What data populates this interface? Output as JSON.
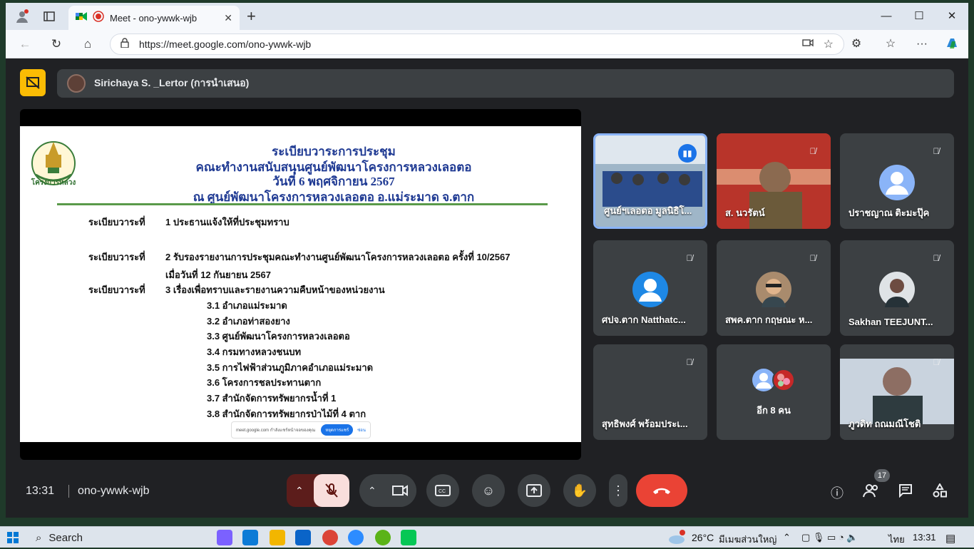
{
  "browser": {
    "tab_title": "Meet - ono-ywwk-wjb",
    "url": "https://meet.google.com/ono-ywwk-wjb"
  },
  "meet": {
    "presenter_name": "Sirichaya S. _Lertor (การนำเสนอ)",
    "time": "13:31",
    "meeting_code": "ono-ywwk-wjb",
    "participant_count": "17"
  },
  "slide": {
    "title_lines": [
      "ระเบียบวาระการประชุม",
      "คณะทำงานสนับสนุนศูนย์พัฒนาโครงการหลวงเลอตอ",
      "วันที่ 6 พฤศจิกายน 2567",
      "ณ ศูนย์พัฒนาโครงการหลวงเลอตอ อ.แม่ระมาด จ.ตาก"
    ],
    "logo_text": "โครงการหลวง",
    "agenda": [
      {
        "label": "ระเบียบวาระที่",
        "text": "1 ประธานแจ้งให้ที่ประชุมทราบ"
      },
      {
        "label": "ระเบียบวาระที่",
        "text": "2 รับรองรายงานการประชุมคณะทำงานศูนย์พัฒนาโครงการหลวงเลอตอ ครั้งที่ 10/2567",
        "text2": "เมื่อวันที่  12 กันยายน 2567"
      },
      {
        "label": "ระเบียบวาระที่",
        "text": "3  เรื่องเพื่อทราบและรายงานความคืบหน้าของหน่วยงาน"
      }
    ],
    "sub_items": [
      "3.1 อำเภอแม่ระมาด",
      "3.2 อำเภอท่าสองยาง",
      "3.3 ศูนย์พัฒนาโครงการหลวงเลอตอ",
      "3.4 กรมทางหลวงชนบท",
      "3.5 การไฟฟ้าส่วนภูมิภาคอำเภอแม่ระมาด",
      "3.6 โครงการชลประทานตาก",
      "3.7 สำนักจัดการทรัพยากรน้ำที่ 1",
      "3.8 สำนักจัดการทรัพยากรป่าไม้ที่ 4 ตาก"
    ],
    "notice": {
      "text": "meet.google.com กำลังแชร์หน้าจอของคุณ",
      "button": "หยุดการแชร์",
      "link": "ซ่อน"
    }
  },
  "tiles": [
    {
      "name": "ศูนย์ฯเลอตอ มูลนิธิโ...",
      "state": "speaking",
      "color": "#7a9cb8"
    },
    {
      "name": "ส. นวรัตน์",
      "state": "muted",
      "color": "#b8342a"
    },
    {
      "name": "ปราชญาณ ติะมะปุ๊ค",
      "state": "muted",
      "color": "#3c4043"
    },
    {
      "name": "ศปจ.ตาก Natthatc...",
      "state": "muted",
      "color": "#3c4043"
    },
    {
      "name": "สพค.ตาก กฤษณะ ห...",
      "state": "muted",
      "color": "#3c4043"
    },
    {
      "name": "Sakhan TEEJUNT...",
      "state": "muted",
      "color": "#3c4043"
    },
    {
      "name": "สุทธิพงศ์ พร้อมประเ...",
      "state": "muted",
      "color": "#3c4043"
    },
    {
      "name": "อีก 8 คน",
      "state": "none",
      "color": "#3c4043"
    },
    {
      "name": "ภูวดิท ถณมณีโชติ",
      "state": "muted",
      "color": "#c9d3de"
    }
  ],
  "taskbar": {
    "search": "Search",
    "weather": "26°C",
    "weather_desc": "มีเมฆส่วนใหญ่",
    "lang": "ไทย",
    "clock": "13:31"
  },
  "colors": {
    "accent": "#1a73e8",
    "end_call": "#ea4335",
    "share_yellow": "#fbbc04",
    "slide_title": "#1f3a93"
  }
}
